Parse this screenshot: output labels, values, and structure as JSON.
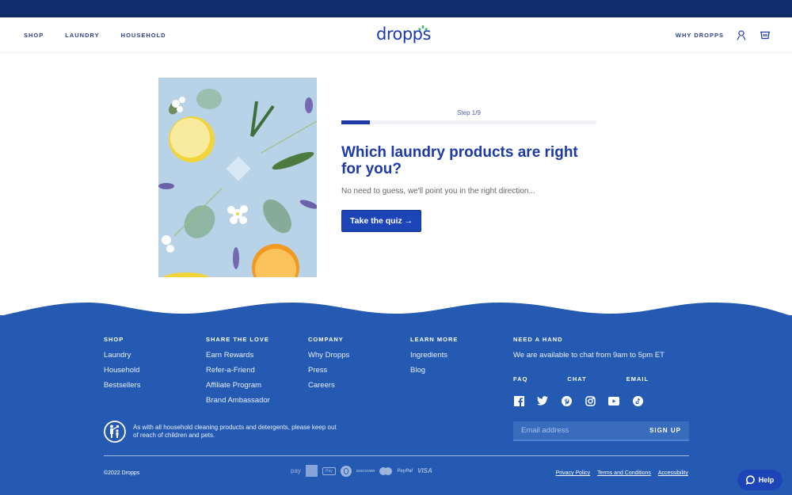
{
  "header": {
    "nav_left": [
      "SHOP",
      "LAUNDRY",
      "HOUSEHOLD"
    ],
    "logo": "dropps",
    "nav_right": "WHY DROPPS",
    "icons": [
      "account-icon",
      "basket-icon"
    ]
  },
  "hero": {
    "image_alt": "Lemon, orange, eucalyptus leaves, lavender and a detergent pod on a light blue background"
  },
  "quiz": {
    "step_label": "Step 1/9",
    "progress_fraction": 0.111,
    "title": "Which laundry products are right for you?",
    "subtitle": "No need to guess, we'll point you in the right direction...",
    "button_label": "Take the quiz →"
  },
  "footer": {
    "columns": [
      {
        "heading": "SHOP",
        "links": [
          "Laundry",
          "Household",
          "Bestsellers"
        ]
      },
      {
        "heading": "SHARE THE LOVE",
        "links": [
          "Earn Rewards",
          "Refer-a-Friend",
          "Affiliate Program",
          "Brand Ambassador"
        ]
      },
      {
        "heading": "COMPANY",
        "links": [
          "Why Dropps",
          "Press",
          "Careers"
        ]
      },
      {
        "heading": "LEARN MORE",
        "links": [
          "Ingredients",
          "Blog"
        ]
      }
    ],
    "help": {
      "heading": "NEED A HAND",
      "text": "We are available to chat from 9am to 5pm ET",
      "contacts": [
        "FAQ",
        "CHAT",
        "EMAIL"
      ],
      "social": [
        "facebook-icon",
        "twitter-icon",
        "pinterest-icon",
        "instagram-icon",
        "youtube-icon",
        "tiktok-icon"
      ]
    },
    "safety_text": "As with all household cleaning products and detergents, please keep out of reach of children and pets.",
    "email_placeholder": "Email address",
    "signup_label": "SIGN UP",
    "copyright": "©2022 Dropps",
    "payments": [
      "Amazon Pay",
      "American Express",
      "Apple Pay",
      "Diners Club",
      "Discover",
      "Mastercard",
      "PayPal",
      "VISA"
    ],
    "legal_links": [
      "Privacy Policy",
      "Terms and Conditions",
      "Accessibility"
    ],
    "help_button": "Help"
  },
  "colors": {
    "top_bar": "#102c6a",
    "brand_blue": "#1e3aa8",
    "footer_blue": "#255ab2",
    "logo_green": "#3fb56a"
  }
}
